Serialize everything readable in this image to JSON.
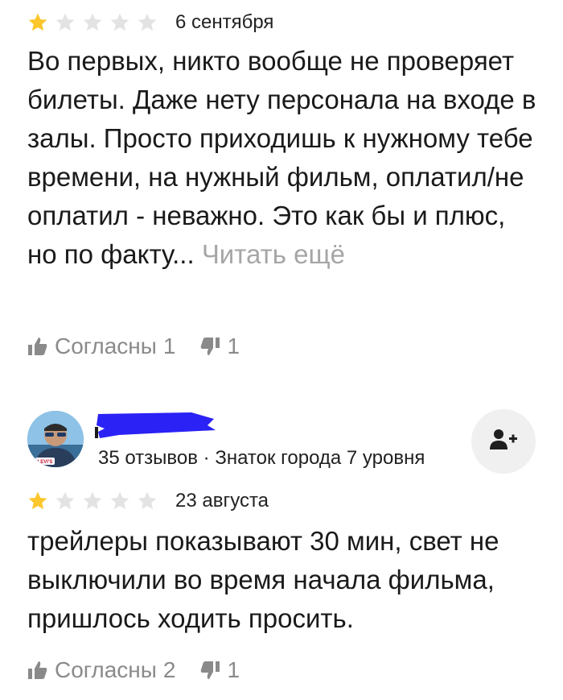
{
  "review1": {
    "rating": 1,
    "date": "6 сентября",
    "text": "Во первых, никто вообще не проверяет билеты. Даже нету персонала на входе в залы. Просто приходишь к нужному тебе времени, на нужный фильм, оплатил/не оплатил - неважно. Это как бы и плюс, но по факту...",
    "read_more": "Читать ещё",
    "agree_label": "Согласны",
    "agree_count": "1",
    "disagree_count": "1"
  },
  "review2": {
    "author": {
      "avatar_badge": "LEVI'S",
      "meta": "35 отзывов · Знаток города 7 уровня"
    },
    "rating": 1,
    "date": "23 августа",
    "text": "трейлеры показывают 30 мин, свет не выключили во время начала фильма, пришлось ходить просить.",
    "agree_label": "Согласны",
    "agree_count": "2",
    "disagree_count": "1"
  },
  "colors": {
    "star_filled": "#fcc62d",
    "star_empty": "#e3e3e3",
    "muted": "#8a8a8a",
    "read_more": "#a6a6a6",
    "redaction": "#2b22f5"
  },
  "icons": [
    "star-icon",
    "thumbs-up-icon",
    "thumbs-down-icon",
    "add-user-icon"
  ]
}
